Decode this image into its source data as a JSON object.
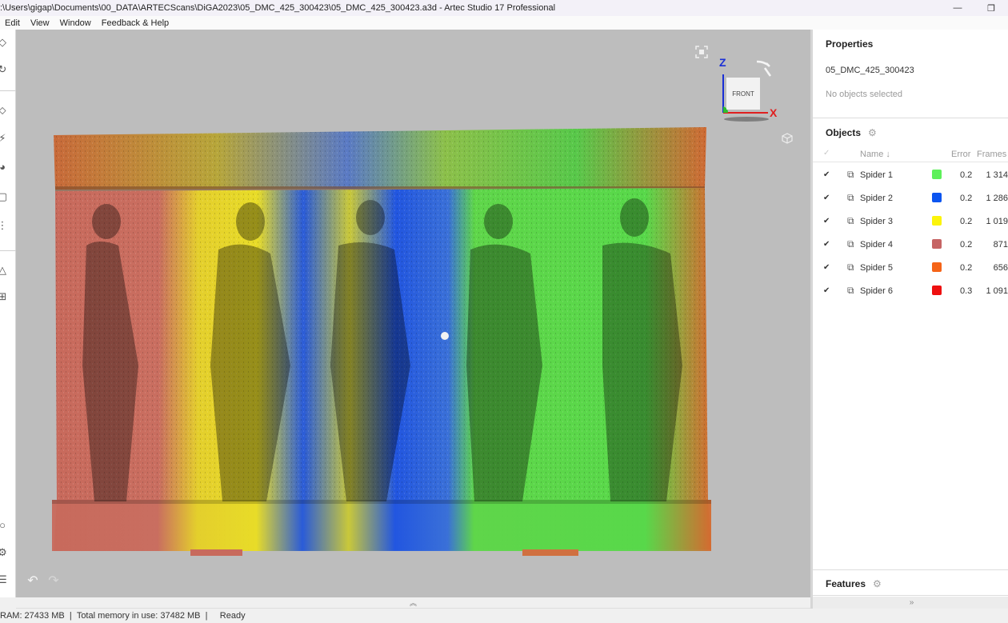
{
  "window": {
    "title": ":\\Users\\gigap\\Documents\\00_DATA\\ARTECScans\\DiGA2023\\05_DMC_425_300423\\05_DMC_425_300423.a3d - Artec Studio 17 Professional",
    "minimize_icon": "minimize-icon",
    "restore_icon": "restore-icon"
  },
  "menu": [
    {
      "label": "Edit"
    },
    {
      "label": "View"
    },
    {
      "label": "Window"
    },
    {
      "label": "Feedback & Help"
    }
  ],
  "left_toolbar": {
    "icons": [
      "scan-icon",
      "autopilot-icon",
      "tools-icon",
      "registration-icon",
      "texture-icon",
      "measures-icon",
      "pattern-icon",
      "cleanup-icon",
      "layout-icon",
      "info-icon",
      "settings-icon",
      "log-icon"
    ]
  },
  "viewport": {
    "gizmo": {
      "z_label": "Z",
      "x_label": "X",
      "face_label": "FRONT"
    },
    "z_color": "#1a2fd6",
    "x_color": "#e01f1f",
    "background": "#bdbdbd"
  },
  "properties": {
    "title": "Properties",
    "object_name": "05_DMC_425_300423",
    "selection_status": "No objects selected"
  },
  "objects": {
    "title": "Objects",
    "columns": {
      "check": "✓",
      "name": "Name ↓",
      "error": "Error",
      "frames": "Frames"
    },
    "rows": [
      {
        "name": "Spider 1",
        "color": "#5ef05a",
        "error": "0.2",
        "frames": "1 314"
      },
      {
        "name": "Spider 2",
        "color": "#0c55f0",
        "error": "0.2",
        "frames": "1 286"
      },
      {
        "name": "Spider 3",
        "color": "#fcf40a",
        "error": "0.2",
        "frames": "1 019"
      },
      {
        "name": "Spider 4",
        "color": "#c66464",
        "error": "0.2",
        "frames": "871"
      },
      {
        "name": "Spider 5",
        "color": "#f56418",
        "error": "0.2",
        "frames": "656"
      },
      {
        "name": "Spider 6",
        "color": "#ee1010",
        "error": "0.3",
        "frames": "1 091"
      }
    ]
  },
  "features": {
    "title": "Features"
  },
  "status": {
    "ram": "RAM: 27433 MB",
    "total": "Total memory in use: 37482 MB",
    "state": "Ready",
    "separator": "|"
  }
}
